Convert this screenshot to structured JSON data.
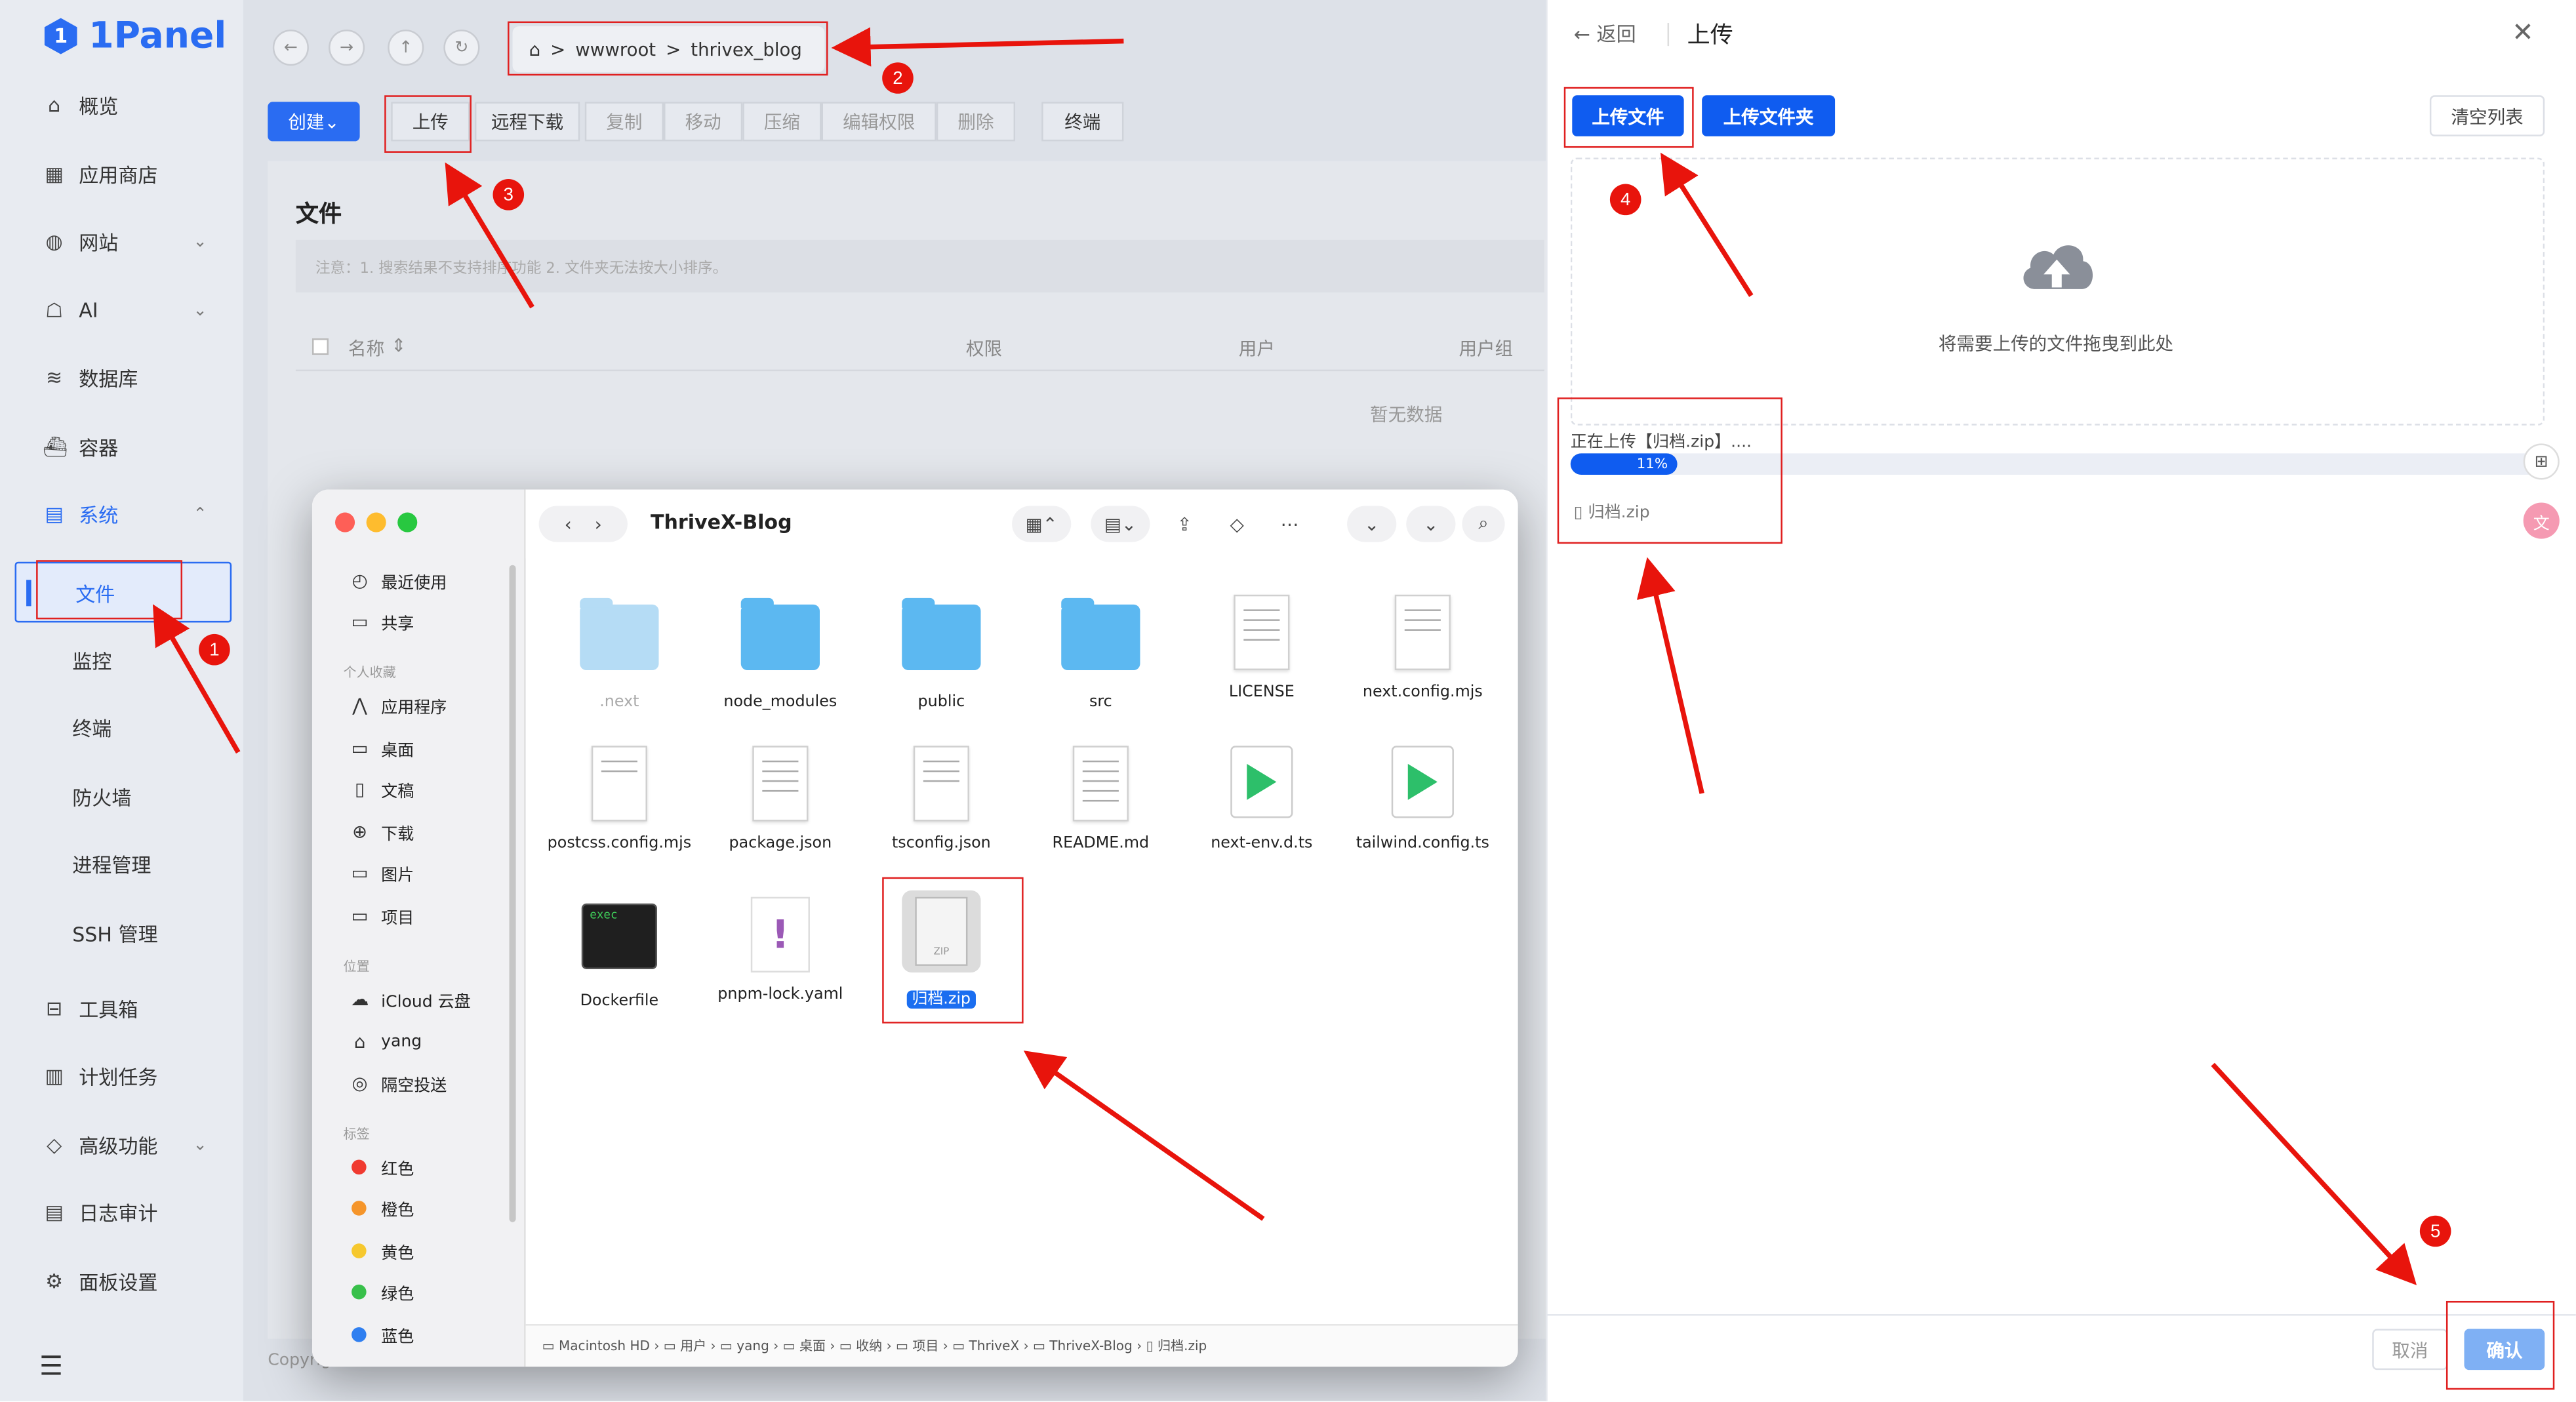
{
  "app": {
    "name": "1Panel",
    "logo_letter": "1"
  },
  "sidebar": {
    "items": [
      {
        "label": "概览",
        "icon": "home-icon"
      },
      {
        "label": "应用商店",
        "icon": "grid-icon"
      },
      {
        "label": "网站",
        "icon": "globe-icon"
      },
      {
        "label": "AI",
        "icon": "robot-icon"
      },
      {
        "label": "数据库",
        "icon": "database-icon"
      },
      {
        "label": "容器",
        "icon": "container-icon"
      },
      {
        "label": "系统",
        "icon": "system-icon"
      },
      {
        "label": "工具箱",
        "icon": "toolbox-icon"
      },
      {
        "label": "计划任务",
        "icon": "calendar-icon"
      },
      {
        "label": "高级功能",
        "icon": "diamond-icon"
      },
      {
        "label": "日志审计",
        "icon": "log-icon"
      },
      {
        "label": "面板设置",
        "icon": "gear-icon"
      }
    ],
    "system_sub": [
      "文件",
      "监控",
      "终端",
      "防火墙",
      "进程管理",
      "SSH 管理"
    ],
    "active": "文件"
  },
  "breadcrumb": {
    "parts": [
      "wwwroot",
      "thrivex_blog"
    ],
    "sep": ">"
  },
  "toolbar": {
    "create": "创建",
    "upload": "上传",
    "remote_download": "远程下载",
    "copy": "复制",
    "move": "移动",
    "compress": "压缩",
    "edit_perm": "编辑权限",
    "delete": "删除",
    "terminal": "终端"
  },
  "file_panel": {
    "title": "文件",
    "notice": "注意：1. 搜索结果不支持排序功能 2. 文件夹无法按大小排序。",
    "columns": [
      "名称",
      "权限",
      "用户",
      "用户组"
    ],
    "empty": "暂无数据",
    "copyright": "Copyright"
  },
  "finder": {
    "title": "ThriveX-Blog",
    "sidebar_top": [
      {
        "label": "最近使用",
        "icon": "clock-icon"
      },
      {
        "label": "共享",
        "icon": "shared-folder-icon"
      }
    ],
    "favorites_header": "个人收藏",
    "favorites": [
      {
        "label": "应用程序",
        "icon": "apps-icon"
      },
      {
        "label": "桌面",
        "icon": "desktop-icon"
      },
      {
        "label": "文稿",
        "icon": "document-icon"
      },
      {
        "label": "下载",
        "icon": "download-icon"
      },
      {
        "label": "图片",
        "icon": "folder-icon"
      },
      {
        "label": "项目",
        "icon": "folder-icon"
      }
    ],
    "locations_header": "位置",
    "locations": [
      {
        "label": "iCloud 云盘",
        "icon": "cloud-icon"
      },
      {
        "label": "yang",
        "icon": "home-icon"
      },
      {
        "label": "隔空投送",
        "icon": "airdrop-icon"
      }
    ],
    "tags_header": "标签",
    "tags": [
      {
        "label": "红色",
        "color": "#f03a30"
      },
      {
        "label": "橙色",
        "color": "#f5952a"
      },
      {
        "label": "黄色",
        "color": "#f6c82e"
      },
      {
        "label": "绿色",
        "color": "#38c04a"
      },
      {
        "label": "蓝色",
        "color": "#2f7ff0"
      }
    ],
    "files": [
      {
        "name": ".next",
        "kind": "folder-light"
      },
      {
        "name": "node_modules",
        "kind": "folder"
      },
      {
        "name": "public",
        "kind": "folder"
      },
      {
        "name": "src",
        "kind": "folder"
      },
      {
        "name": "LICENSE",
        "kind": "doc"
      },
      {
        "name": "next.config.mjs",
        "kind": "doc"
      },
      {
        "name": "postcss.config.mjs",
        "kind": "doc"
      },
      {
        "name": "package.json",
        "kind": "doc"
      },
      {
        "name": "tsconfig.json",
        "kind": "doc"
      },
      {
        "name": "README.md",
        "kind": "doc"
      },
      {
        "name": "next-env.d.ts",
        "kind": "play"
      },
      {
        "name": "tailwind.config.ts",
        "kind": "play"
      },
      {
        "name": "Dockerfile",
        "kind": "terminal"
      },
      {
        "name": "pnpm-lock.yaml",
        "kind": "yaml"
      },
      {
        "name": "归档.zip",
        "kind": "zip",
        "selected": true
      }
    ],
    "path": [
      "Macintosh HD",
      "用户",
      "yang",
      "桌面",
      "收纳",
      "项目",
      "ThriveX",
      "ThriveX-Blog",
      "归档.zip"
    ],
    "path_sep": "›",
    "term_label": "exec",
    "zip_label": "ZIP"
  },
  "upload_drawer": {
    "back": "返回",
    "title": "上传",
    "upload_file": "上传文件",
    "upload_folder": "上传文件夹",
    "clear_list": "清空列表",
    "drop_hint": "将需要上传的文件拖曳到此处",
    "status": "正在上传【归档.zip】....",
    "progress": 11,
    "progress_label": "11%",
    "file_name": "归档.zip",
    "cancel": "取消",
    "confirm": "确认"
  },
  "annotations": {
    "steps": [
      "1",
      "2",
      "3",
      "4",
      "5"
    ],
    "color": "#e02020"
  }
}
